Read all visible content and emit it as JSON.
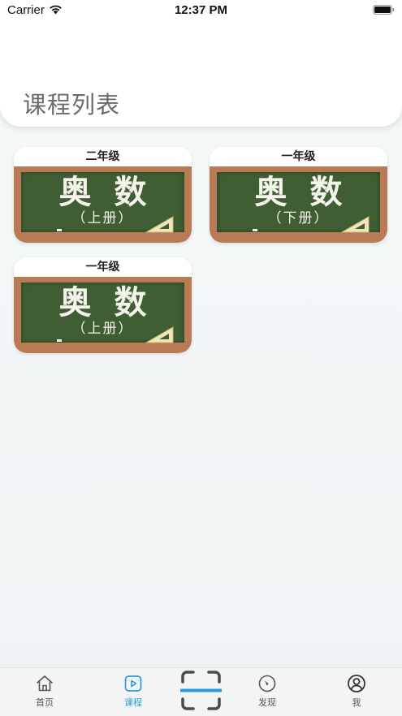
{
  "status_bar": {
    "carrier": "Carrier",
    "time": "12:37 PM"
  },
  "header": {
    "title": "课程列表"
  },
  "courses": [
    {
      "grade": "二年级",
      "title": "奥数",
      "volume": "（上册）"
    },
    {
      "grade": "一年级",
      "title": "奥数",
      "volume": "（下册）"
    },
    {
      "grade": "一年级",
      "title": "奥数",
      "volume": "（上册）"
    }
  ],
  "tab_bar": {
    "items": [
      {
        "label": "首页",
        "icon": "home-icon",
        "active": false
      },
      {
        "label": "课程",
        "icon": "play-icon",
        "active": true
      },
      {
        "label": "",
        "icon": "scan-icon",
        "active": false
      },
      {
        "label": "发现",
        "icon": "compass-icon",
        "active": false
      },
      {
        "label": "我",
        "icon": "user-icon",
        "active": false
      }
    ]
  },
  "colors": {
    "accent": "#2a9be0",
    "board_green": "#3f5e33",
    "board_frame": "#b97a56"
  }
}
